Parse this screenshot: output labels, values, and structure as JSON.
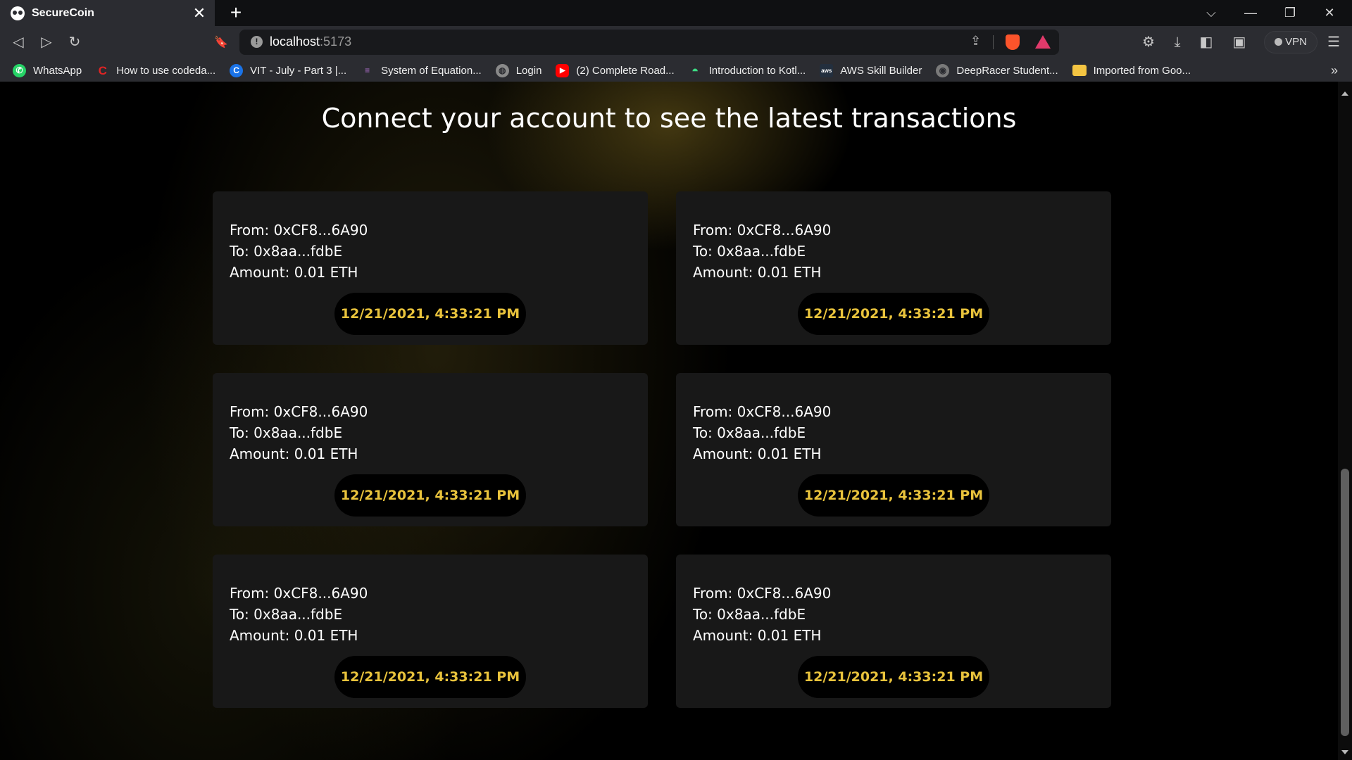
{
  "browser": {
    "tab": {
      "title": "SecureCoin",
      "close": "✕"
    },
    "new_tab": "+",
    "window": {
      "dropdown": "⌵",
      "minimize": "—",
      "restore": "❐",
      "close": "✕"
    },
    "nav": {
      "back": "◁",
      "forward": "▷",
      "reload": "↻",
      "bookmark": "🔖"
    },
    "address": {
      "host": "localhost",
      "port": ":5173",
      "info": "!",
      "share": "⇪"
    },
    "toolbar_right": {
      "extensions": "⚙",
      "downloads": "⤓",
      "sidebar": "◧",
      "wallet": "▣",
      "vpn": "VPN",
      "menu": "☰"
    },
    "bookmarks": [
      {
        "label": "WhatsApp",
        "icon": "whatsapp-icon",
        "color": "#25d366",
        "glyph": "✆"
      },
      {
        "label": "How to use codeda...",
        "icon": "codechef-icon",
        "color": "#e02424",
        "glyph": "C"
      },
      {
        "label": "VIT - July - Part 3 |...",
        "icon": "c-logo-icon",
        "color": "#1a73e8",
        "glyph": "C"
      },
      {
        "label": "System of Equation...",
        "icon": "sketch-icon",
        "color": "#6b3fa0",
        "glyph": "≡"
      },
      {
        "label": "Login",
        "icon": "globe-icon",
        "color": "#8a8a8a",
        "glyph": "◍"
      },
      {
        "label": "(2) Complete Road...",
        "icon": "youtube-icon",
        "color": "#ff0000",
        "glyph": "▶"
      },
      {
        "label": "Introduction to Kotl...",
        "icon": "android-icon",
        "color": "#3ddc84",
        "glyph": "◓"
      },
      {
        "label": "AWS Skill Builder",
        "icon": "aws-icon",
        "color": "#232f3e",
        "glyph": "aws"
      },
      {
        "label": "DeepRacer Student...",
        "icon": "deepracer-icon",
        "color": "#7a7a7a",
        "glyph": "◉"
      },
      {
        "label": "Imported from Goo...",
        "icon": "folder-icon",
        "color": "#f4c542",
        "glyph": ""
      }
    ],
    "bookmarks_more": "»"
  },
  "page": {
    "heading": "Connect your account to see the latest transactions",
    "transactions": [
      {
        "from": "From: 0xCF8...6A90",
        "to": "To: 0x8aa...fdbE",
        "amount": "Amount: 0.01 ETH",
        "timestamp": "12/21/2021, 4:33:21 PM"
      },
      {
        "from": "From: 0xCF8...6A90",
        "to": "To: 0x8aa...fdbE",
        "amount": "Amount: 0.01 ETH",
        "timestamp": "12/21/2021, 4:33:21 PM"
      },
      {
        "from": "From: 0xCF8...6A90",
        "to": "To: 0x8aa...fdbE",
        "amount": "Amount: 0.01 ETH",
        "timestamp": "12/21/2021, 4:33:21 PM"
      },
      {
        "from": "From: 0xCF8...6A90",
        "to": "To: 0x8aa...fdbE",
        "amount": "Amount: 0.01 ETH",
        "timestamp": "12/21/2021, 4:33:21 PM"
      },
      {
        "from": "From: 0xCF8...6A90",
        "to": "To: 0x8aa...fdbE",
        "amount": "Amount: 0.01 ETH",
        "timestamp": "12/21/2021, 4:33:21 PM"
      },
      {
        "from": "From: 0xCF8...6A90",
        "to": "To: 0x8aa...fdbE",
        "amount": "Amount: 0.01 ETH",
        "timestamp": "12/21/2021, 4:33:21 PM"
      }
    ]
  }
}
